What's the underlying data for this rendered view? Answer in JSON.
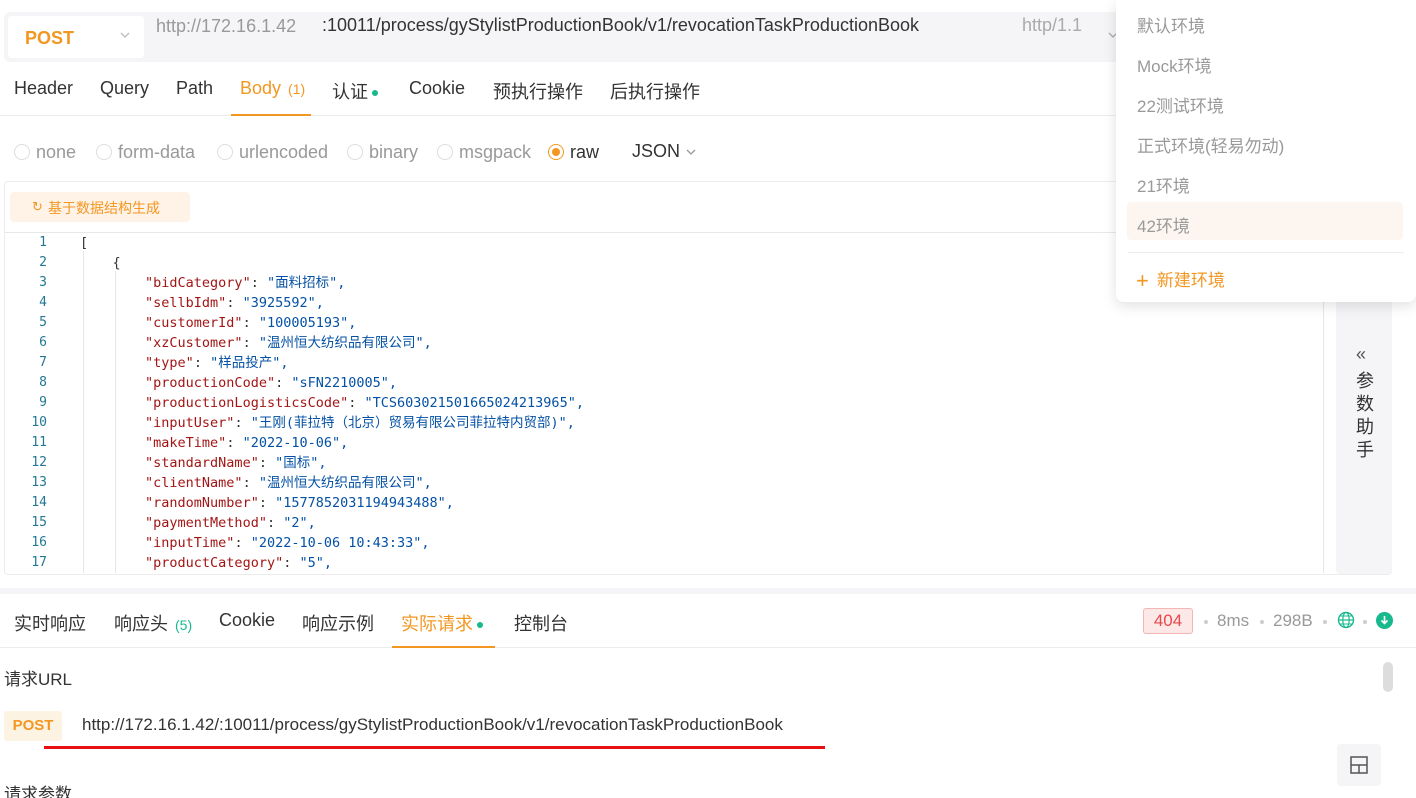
{
  "request": {
    "method": "POST",
    "url_host": "http://172.16.1.42",
    "url_path": ":10011/process/gyStylistProductionBook/v1/revocationTaskProductionBook",
    "protocol": "http/1.1"
  },
  "req_tabs": [
    {
      "label": "Header"
    },
    {
      "label": "Query"
    },
    {
      "label": "Path"
    },
    {
      "label": "Body",
      "count": "(1)"
    },
    {
      "label": "认证"
    },
    {
      "label": "Cookie"
    },
    {
      "label": "预执行操作"
    },
    {
      "label": "后执行操作"
    }
  ],
  "body_types": [
    "none",
    "form-data",
    "urlencoded",
    "binary",
    "msgpack",
    "raw"
  ],
  "body_format": "JSON",
  "generate_button": "基于数据结构生成",
  "code_lines": [
    {
      "n": "1",
      "indent": "",
      "text": "["
    },
    {
      "n": "2",
      "indent": "    ",
      "text": "{"
    },
    {
      "n": "3",
      "indent": "        ",
      "key": "\"bidCategory\"",
      "val": "\"面料招标\","
    },
    {
      "n": "4",
      "indent": "        ",
      "key": "\"sellbIdm\"",
      "val": "\"3925592\","
    },
    {
      "n": "5",
      "indent": "        ",
      "key": "\"customerId\"",
      "val": "\"100005193\","
    },
    {
      "n": "6",
      "indent": "        ",
      "key": "\"xzCustomer\"",
      "val": "\"温州恒大纺织品有限公司\","
    },
    {
      "n": "7",
      "indent": "        ",
      "key": "\"type\"",
      "val": "\"样品投产\","
    },
    {
      "n": "8",
      "indent": "        ",
      "key": "\"productionCode\"",
      "val": "\"sFN2210005\","
    },
    {
      "n": "9",
      "indent": "        ",
      "key": "\"productionLogisticsCode\"",
      "val": "\"TCS603021501665024213965\","
    },
    {
      "n": "10",
      "indent": "        ",
      "key": "\"inputUser\"",
      "val": "\"王刚(菲拉特（北京）贸易有限公司菲拉特内贸部)\","
    },
    {
      "n": "11",
      "indent": "        ",
      "key": "\"makeTime\"",
      "val": "\"2022-10-06\","
    },
    {
      "n": "12",
      "indent": "        ",
      "key": "\"standardName\"",
      "val": "\"国标\","
    },
    {
      "n": "13",
      "indent": "        ",
      "key": "\"clientName\"",
      "val": "\"温州恒大纺织品有限公司\","
    },
    {
      "n": "14",
      "indent": "        ",
      "key": "\"randomNumber\"",
      "val": "\"1577852031194943488\","
    },
    {
      "n": "15",
      "indent": "        ",
      "key": "\"paymentMethod\"",
      "val": "\"2\","
    },
    {
      "n": "16",
      "indent": "        ",
      "key": "\"inputTime\"",
      "val": "\"2022-10-06 10:43:33\","
    },
    {
      "n": "17",
      "indent": "        ",
      "key": "\"productCategory\"",
      "val": "\"5\","
    }
  ],
  "helper": {
    "chevron": "«",
    "label": "参数助手"
  },
  "resp_tabs": [
    {
      "label": "实时响应"
    },
    {
      "label": "响应头",
      "count": "(5)"
    },
    {
      "label": "Cookie"
    },
    {
      "label": "响应示例"
    },
    {
      "label": "实际请求"
    },
    {
      "label": "控制台"
    }
  ],
  "response_meta": {
    "status": "404",
    "time": "8ms",
    "size": "298B"
  },
  "actual_request": {
    "url_label": "请求URL",
    "method": "POST",
    "full_url": "http://172.16.1.42/:10011/process/gyStylistProductionBook/v1/revocationTaskProductionBook",
    "params_label": "请求参数"
  },
  "environments": {
    "items": [
      "默认环境",
      "Mock环境",
      "22测试环境",
      "正式环境(轻易勿动)",
      "21环境",
      "42环境"
    ],
    "selected": "42环境",
    "new_label": "新建环境"
  },
  "colors": {
    "accent": "#f29722",
    "success": "#19b98e",
    "error": "#e5484d"
  }
}
